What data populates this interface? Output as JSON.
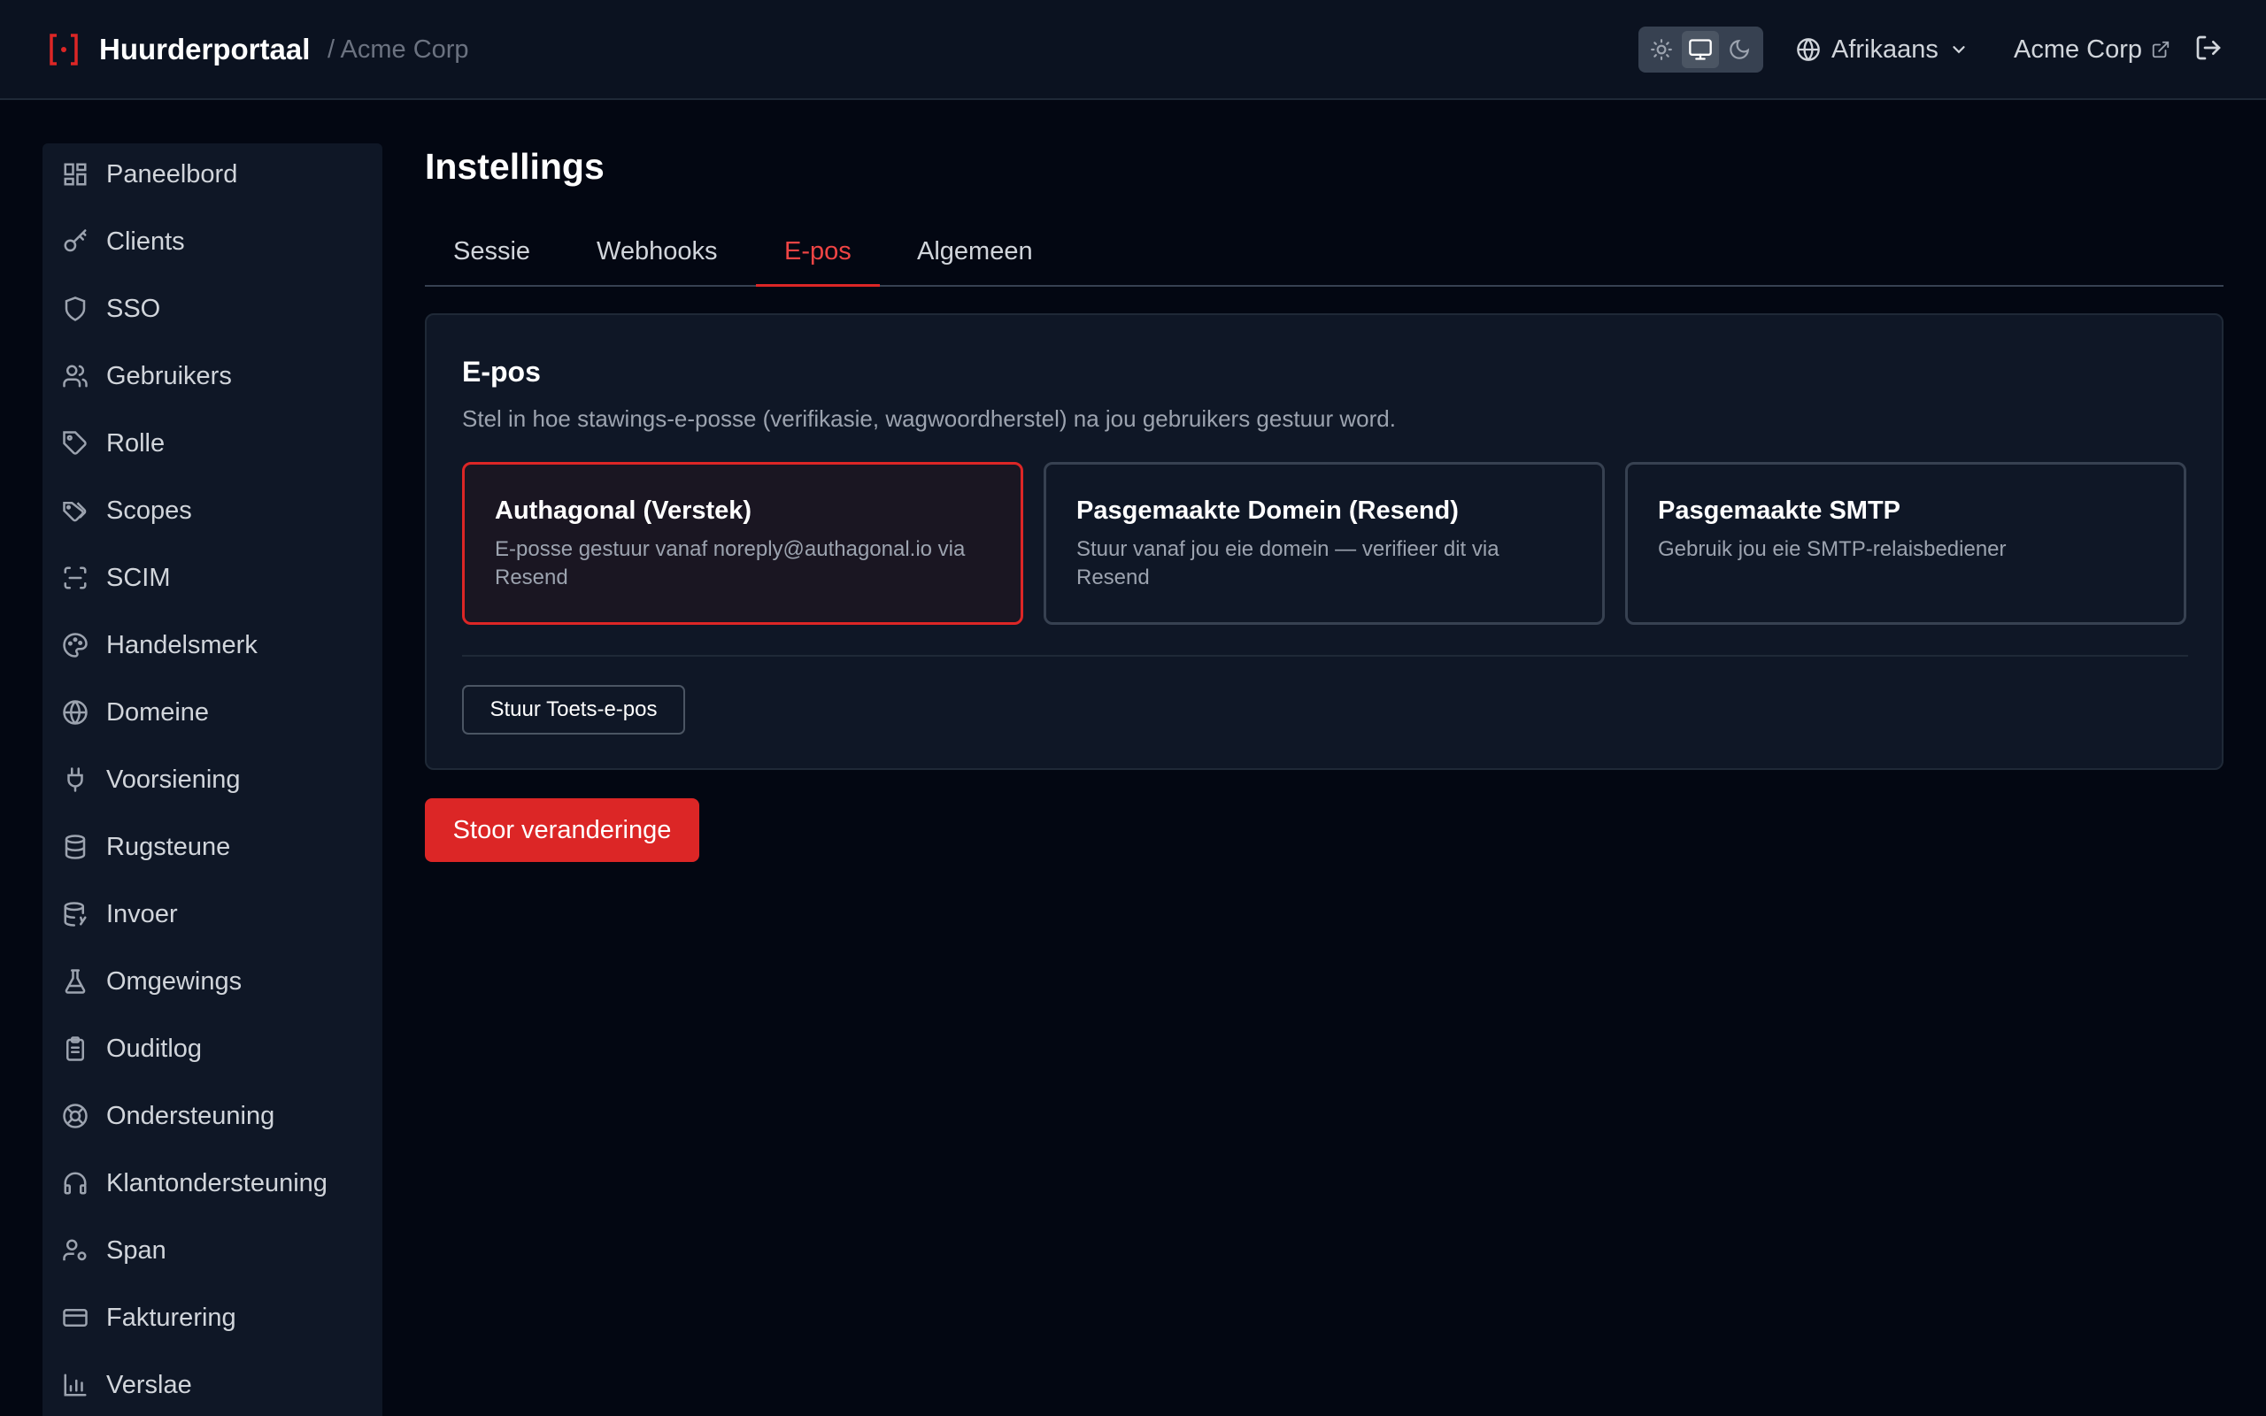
{
  "header": {
    "brand_name": "Huurderportaal",
    "tenant_breadcrumb": "/ Acme Corp",
    "theme_options": [
      "sun-icon",
      "monitor-icon",
      "moon-icon"
    ],
    "theme_active": "monitor-icon",
    "language": "Afrikaans",
    "tenant_link": "Acme Corp"
  },
  "sidebar": {
    "items": [
      {
        "label": "Paneelbord",
        "icon": "dashboard-icon"
      },
      {
        "label": "Clients",
        "icon": "key-icon"
      },
      {
        "label": "SSO",
        "icon": "shield-icon"
      },
      {
        "label": "Gebruikers",
        "icon": "users-icon"
      },
      {
        "label": "Rolle",
        "icon": "tag-icon"
      },
      {
        "label": "Scopes",
        "icon": "tags-icon"
      },
      {
        "label": "SCIM",
        "icon": "scan-icon"
      },
      {
        "label": "Handelsmerk",
        "icon": "palette-icon"
      },
      {
        "label": "Domeine",
        "icon": "globe-icon"
      },
      {
        "label": "Voorsiening",
        "icon": "plug-icon"
      },
      {
        "label": "Rugsteune",
        "icon": "database-icon"
      },
      {
        "label": "Invoer",
        "icon": "database-import-icon"
      },
      {
        "label": "Omgewings",
        "icon": "flask-icon"
      },
      {
        "label": "Ouditlog",
        "icon": "clipboard-icon"
      },
      {
        "label": "Ondersteuning",
        "icon": "lifebuoy-icon"
      },
      {
        "label": "Klantondersteuning",
        "icon": "headset-icon"
      },
      {
        "label": "Span",
        "icon": "user-cog-icon"
      },
      {
        "label": "Fakturering",
        "icon": "credit-card-icon"
      },
      {
        "label": "Verslae",
        "icon": "bar-chart-icon"
      }
    ]
  },
  "main": {
    "title": "Instellings",
    "tabs": [
      {
        "label": "Sessie"
      },
      {
        "label": "Webhooks"
      },
      {
        "label": "E-pos"
      },
      {
        "label": "Algemeen"
      }
    ],
    "active_tab": "E-pos",
    "card": {
      "title": "E-pos",
      "description": "Stel in hoe stawings-e-posse (verifikasie, wagwoordherstel) na jou gebruikers gestuur word.",
      "options": [
        {
          "title": "Authagonal (Verstek)",
          "description": "E-posse gestuur vanaf noreply@authagonal.io via Resend",
          "selected": true
        },
        {
          "title": "Pasgemaakte Domein (Resend)",
          "description": "Stuur vanaf jou eie domein — verifieer dit via Resend",
          "selected": false
        },
        {
          "title": "Pasgemaakte SMTP",
          "description": "Gebruik jou eie SMTP-relaisbediener",
          "selected": false
        }
      ],
      "test_button": "Stuur Toets-e-pos"
    },
    "save_button": "Stoor veranderinge"
  },
  "colors": {
    "accent": "#dc2626",
    "background": "#030712",
    "surface": "#0f1726"
  }
}
